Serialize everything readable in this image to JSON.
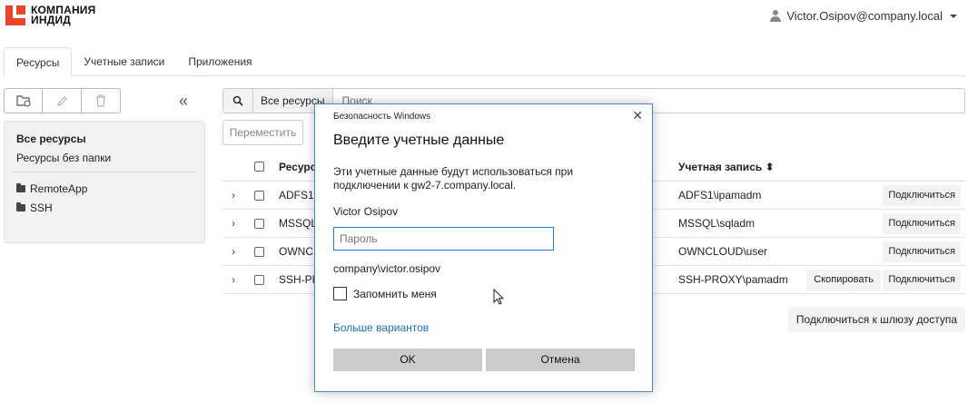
{
  "brand": {
    "line1": "КОМПАНИЯ",
    "line2": "ИНДИД"
  },
  "user": {
    "email": "Victor.Osipov@company.local"
  },
  "tabs": [
    {
      "label": "Ресурсы"
    },
    {
      "label": "Учетные записи"
    },
    {
      "label": "Приложения"
    }
  ],
  "sidebar": {
    "all_resources": "Все ресурсы",
    "no_folder": "Ресурсы без папки",
    "folders": [
      {
        "label": "RemoteApp"
      },
      {
        "label": "SSH"
      }
    ],
    "collapse_icon": "«"
  },
  "search": {
    "scope": "Все ресурсы",
    "placeholder": "Поиск"
  },
  "move_button": "Переместить",
  "table": {
    "headers": {
      "resource": "Ресурс",
      "account": "Учетная запись ⬍"
    },
    "connect_label": "Подключиться",
    "copy_label": "Скопировать",
    "rows": [
      {
        "resource": "ADFS1",
        "account": "ADFS1\\ipamadm"
      },
      {
        "resource": "MSSQL",
        "account": "MSSQL\\sqladm"
      },
      {
        "resource": "OWNCL",
        "account": "OWNCLOUD\\user"
      },
      {
        "resource": "SSH-PRO",
        "account": "SSH-PROXY\\pamadm"
      }
    ]
  },
  "gateway_button": "Подключиться к шлюзу доступа",
  "dialog": {
    "caption": "Безопасность Windows",
    "close": "✕",
    "heading": "Введите учетные данные",
    "description": "Эти учетные данные будут использоваться при подключении к gw2-7.company.local.",
    "username": "Victor Osipov",
    "password_placeholder": "Пароль",
    "domain": "company\\victor.osipov",
    "remember": "Запомнить меня",
    "more": "Больше вариантов",
    "ok": "OK",
    "cancel": "Отмена"
  }
}
